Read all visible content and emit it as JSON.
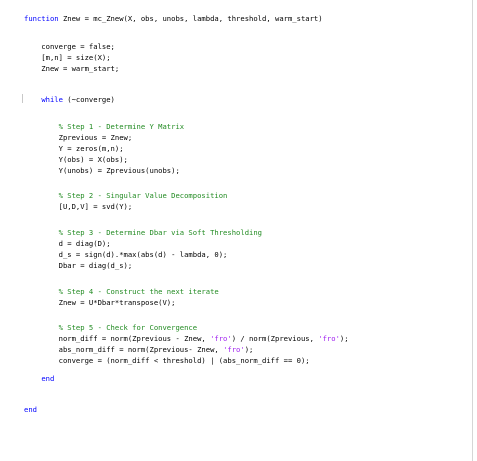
{
  "code_lines": [
    {
      "parts": [
        {
          "t": "function",
          "c": "kw"
        },
        {
          "t": " Znew = mc_Znew(X, obs, unobs, lambda, threshold, warm_start)",
          "c": ""
        }
      ]
    },
    {
      "parts": [
        {
          "t": "    converge = false;",
          "c": ""
        }
      ]
    },
    {
      "parts": [
        {
          "t": "    [m,n] = size(X);",
          "c": ""
        }
      ]
    },
    {
      "parts": [
        {
          "t": "    Znew = warm_start;",
          "c": ""
        }
      ]
    },
    {
      "parts": [
        {
          "t": "    ",
          "c": ""
        },
        {
          "t": "while",
          "c": "kw"
        },
        {
          "t": " (~converge)",
          "c": ""
        }
      ]
    },
    {
      "parts": [
        {
          "t": "        % Step 1 - Determine Y Matrix",
          "c": "cm"
        }
      ]
    },
    {
      "parts": [
        {
          "t": "        Zprevious = Znew;",
          "c": ""
        }
      ]
    },
    {
      "parts": [
        {
          "t": "        Y = zeros(m,n);",
          "c": ""
        }
      ]
    },
    {
      "parts": [
        {
          "t": "        Y(obs) = X(obs);",
          "c": ""
        }
      ]
    },
    {
      "parts": [
        {
          "t": "        Y(unobs) = Zprevious(unobs);",
          "c": ""
        }
      ]
    },
    {
      "parts": [
        {
          "t": "        % Step 2 - Singular Value Decomposition",
          "c": "cm"
        }
      ]
    },
    {
      "parts": [
        {
          "t": "        [U,D,V] = svd(Y);",
          "c": ""
        }
      ]
    },
    {
      "parts": [
        {
          "t": "        % Step 3 - Determine Dbar via Soft Thresholding",
          "c": "cm"
        }
      ]
    },
    {
      "parts": [
        {
          "t": "        d = diag(D);",
          "c": ""
        }
      ]
    },
    {
      "parts": [
        {
          "t": "        d_s = sign(d).*max(abs(d) - lambda, 0);",
          "c": ""
        }
      ]
    },
    {
      "parts": [
        {
          "t": "        Dbar = diag(d_s);",
          "c": ""
        }
      ]
    },
    {
      "parts": [
        {
          "t": "        % Step 4 - Construct the next iterate",
          "c": "cm"
        }
      ]
    },
    {
      "parts": [
        {
          "t": "        Znew = U*Dbar*transpose(V);",
          "c": ""
        }
      ]
    },
    {
      "parts": [
        {
          "t": "        % Step 5 - Check for Convergence",
          "c": "cm"
        }
      ]
    },
    {
      "parts": [
        {
          "t": "        norm_diff = norm(Zprevious - Znew, ",
          "c": ""
        },
        {
          "t": "'fro'",
          "c": "st"
        },
        {
          "t": ") / norm(Zprevious, ",
          "c": ""
        },
        {
          "t": "'fro'",
          "c": "st"
        },
        {
          "t": ");",
          "c": ""
        }
      ]
    },
    {
      "parts": [
        {
          "t": "        abs_norm_diff = norm(Zprevious- Znew, ",
          "c": ""
        },
        {
          "t": "'fro'",
          "c": "st"
        },
        {
          "t": ");",
          "c": ""
        }
      ]
    },
    {
      "parts": [
        {
          "t": "        converge = (norm_diff < threshold) | (abs_norm_diff == 0);",
          "c": ""
        }
      ]
    },
    {
      "parts": [
        {
          "t": "    ",
          "c": ""
        },
        {
          "t": "end",
          "c": "kw"
        }
      ]
    },
    {
      "parts": [
        {
          "t": "end",
          "c": "kw"
        }
      ]
    }
  ],
  "colors": {
    "keyword": "#0000ff",
    "comment": "#228b22",
    "string": "#a020f0",
    "text": "#000000",
    "background": "#ffffff"
  }
}
